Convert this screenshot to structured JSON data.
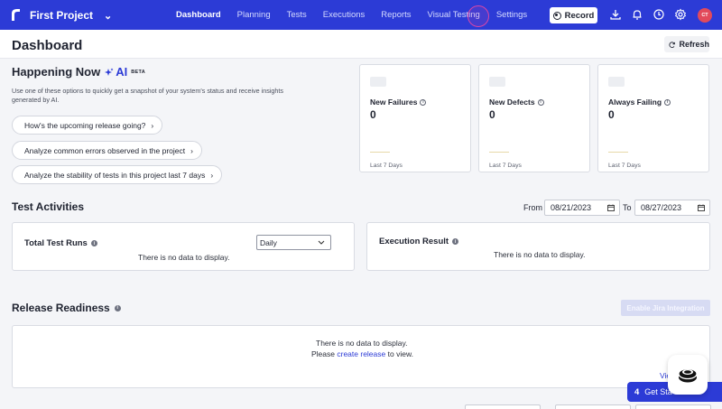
{
  "nav": {
    "project": "First Project",
    "links": [
      "Dashboard",
      "Planning",
      "Tests",
      "Executions",
      "Reports",
      "Visual Testing",
      "Settings"
    ],
    "active": "Dashboard",
    "record_label": "Record",
    "avatar_initials": "CT",
    "accent": "#2c3bd6"
  },
  "header": {
    "title": "Dashboard",
    "refresh_label": "Refresh"
  },
  "happening": {
    "title": "Happening Now",
    "ai_label": "AI",
    "beta": "BETA",
    "description": "Use one of these options to quickly get a snapshot of your system's status and receive insights generated by AI.",
    "prompts": [
      "How's the upcoming release going?",
      "Analyze common errors observed in the project",
      "Analyze the stability of tests in this project last 7 days"
    ]
  },
  "stats": [
    {
      "label": "New Failures",
      "value": "0",
      "footer": "Last 7 Days"
    },
    {
      "label": "New Defects",
      "value": "0",
      "footer": "Last 7 Days"
    },
    {
      "label": "Always Failing",
      "value": "0",
      "footer": "Last 7 Days"
    }
  ],
  "activities": {
    "title": "Test Activities",
    "from_label": "From",
    "from_value": "08/21/2023",
    "to_label": "To",
    "to_value": "08/27/2023",
    "total_runs_title": "Total Test Runs",
    "interval": "Daily",
    "no_data": "There is no data to display.",
    "execution_title": "Execution Result"
  },
  "release": {
    "title": "Release Readiness",
    "jira_button": "Enable Jira Integration",
    "no_data": "There is no data to display.",
    "please": "Please",
    "create_link": "create release",
    "to_view": "to view.",
    "view_link": "Vie"
  },
  "get_started": {
    "count": "4",
    "label": "Get Sta"
  }
}
